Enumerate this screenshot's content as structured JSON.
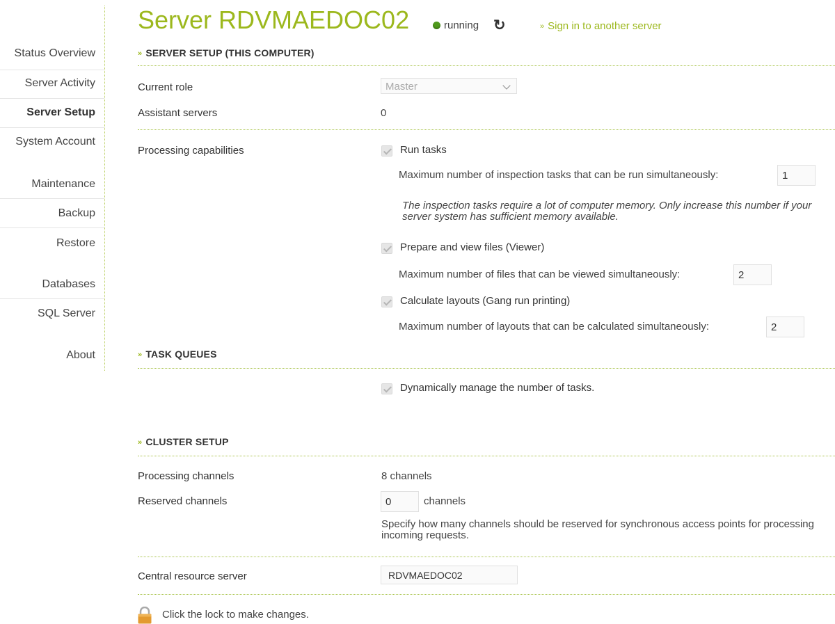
{
  "header": {
    "title": "Server RDVMAEDOC02",
    "status_text": "running",
    "signin_link": "Sign in to another server"
  },
  "sidebar": {
    "items": [
      {
        "label": "Status Overview"
      },
      {
        "label": "Server Activity"
      },
      {
        "label": "Server Setup",
        "active": true
      },
      {
        "label": "System Account"
      },
      {
        "label": "Maintenance"
      },
      {
        "label": "Backup"
      },
      {
        "label": "Restore"
      },
      {
        "label": "Databases"
      },
      {
        "label": "SQL Server"
      },
      {
        "label": "About"
      }
    ]
  },
  "server_setup": {
    "heading": "SERVER SETUP (THIS COMPUTER)",
    "current_role_label": "Current role",
    "current_role_value": "Master",
    "assistant_servers_label": "Assistant servers",
    "assistant_servers_value": "0",
    "processing_label": "Processing capabilities",
    "run_tasks_label": "Run tasks",
    "run_tasks_checked": true,
    "max_inspection_label": "Maximum number of inspection tasks that can be run simultaneously:",
    "max_inspection_value": "1",
    "memory_note": "The inspection tasks require a lot of computer memory. Only increase this number if your server system has sufficient memory available.",
    "viewer_label": "Prepare and view files (Viewer)",
    "viewer_checked": true,
    "max_viewed_label": "Maximum number of files that can be viewed simultaneously:",
    "max_viewed_value": "2",
    "layouts_label": "Calculate layouts (Gang run printing)",
    "layouts_checked": true,
    "max_layouts_label": "Maximum number of layouts that can be calculated simultaneously:",
    "max_layouts_value": "2"
  },
  "task_queues": {
    "heading": "TASK QUEUES",
    "dynamic_label": "Dynamically manage the number of tasks.",
    "dynamic_checked": true
  },
  "cluster_setup": {
    "heading": "CLUSTER SETUP",
    "processing_channels_label": "Processing channels",
    "processing_channels_value": "8 channels",
    "reserved_channels_label": "Reserved channels",
    "reserved_channels_value": "0",
    "reserved_channels_unit": "channels",
    "reserved_note": "Specify how many channels should be reserved for synchronous access points for processing incoming requests.",
    "central_resource_label": "Central resource server",
    "central_resource_value": "RDVMAEDOC02"
  },
  "footer": {
    "lock_text": "Click the lock to make changes."
  },
  "colors": {
    "accent": "#9cb81d",
    "status_running": "#4f9a1c"
  }
}
